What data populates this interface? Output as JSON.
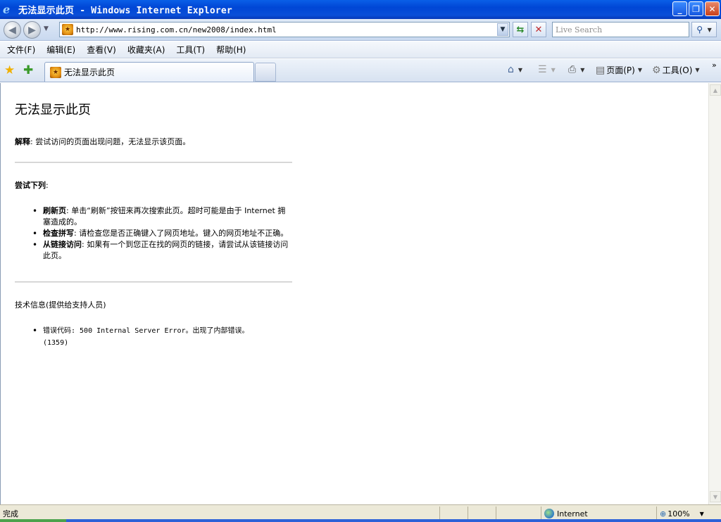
{
  "window": {
    "title": "无法显示此页 - Windows Internet Explorer",
    "buttons": {
      "minimize": "_",
      "maximize": "❐",
      "close": "✕"
    }
  },
  "nav": {
    "back_icon": "back-arrow-icon",
    "forward_icon": "forward-arrow-icon",
    "address": "http://www.rising.com.cn/new2008/index.html",
    "search_placeholder": "Live Search"
  },
  "menu": [
    "文件(F)",
    "编辑(E)",
    "查看(V)",
    "收藏夹(A)",
    "工具(T)",
    "帮助(H)"
  ],
  "tabs": [
    {
      "label": "无法显示此页",
      "active": true
    }
  ],
  "commandbar": {
    "page_label": "页面(P)",
    "tools_label": "工具(O)"
  },
  "content": {
    "heading": "无法显示此页",
    "explain_label": "解释",
    "explain_text": ": 尝试访问的页面出现问题，无法显示该页面。",
    "try_label": "尝试下列",
    "try_suffix": ":",
    "suggestions": [
      {
        "label": "刷新页",
        "text": ": 单击“刷新”按钮来再次搜索此页。超时可能是由于 Internet 拥塞造成的。"
      },
      {
        "label": "检查拼写",
        "text": ": 请检查您是否正确键入了网页地址。键入的网页地址不正确。"
      },
      {
        "label": "从链接访问",
        "text": ": 如果有一个到您正在找的网页的链接，请尝试从该链接访问此页。"
      }
    ],
    "tech_info": "技术信息(提供给支持人员)",
    "error_line": "错误代码: 500 Internal Server Error。出现了内部错误。",
    "error_code": "(1359)"
  },
  "status": {
    "text": "完成",
    "zone": "Internet",
    "zoom": "100%"
  },
  "colors": {
    "titlebar": "#0054e3",
    "accent": "#2d62d8"
  }
}
